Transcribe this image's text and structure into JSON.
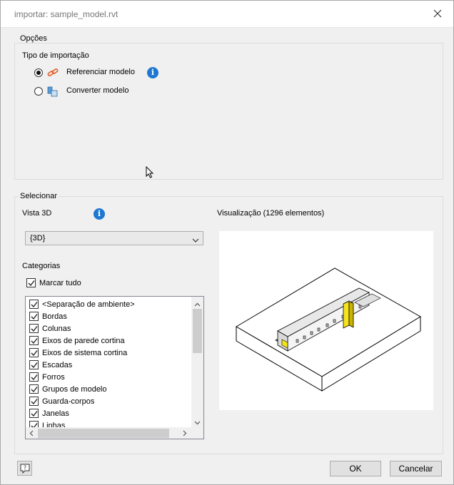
{
  "window": {
    "title": "importar: sample_model.rvt",
    "close_icon": "close-icon"
  },
  "options": {
    "group_label": "Opções",
    "import_type_label": "Tipo de importação",
    "radios": [
      {
        "label": "Referenciar modelo",
        "selected": true,
        "icon": "link-icon"
      },
      {
        "label": "Converter modelo",
        "selected": false,
        "icon": "convert-model-icon"
      }
    ],
    "info_icon": "info-icon",
    "info_glyph": "i"
  },
  "select": {
    "group_label": "Selecionar",
    "view3d_label": "Vista 3D",
    "view3d_value": "{3D}",
    "info_glyph": "i",
    "preview_label": "Visualização (1296 elementos)",
    "categories_label": "Categorias",
    "check_all_label": "Marcar tudo",
    "check_all_checked": true,
    "categories": [
      {
        "label": "<Separação de ambiente>",
        "checked": true
      },
      {
        "label": "Bordas",
        "checked": true
      },
      {
        "label": "Colunas",
        "checked": true
      },
      {
        "label": "Eixos de parede cortina",
        "checked": true
      },
      {
        "label": "Eixos de sistema cortina",
        "checked": true
      },
      {
        "label": "Escadas",
        "checked": true
      },
      {
        "label": "Forros",
        "checked": true
      },
      {
        "label": "Grupos de modelo",
        "checked": true
      },
      {
        "label": "Guarda-corpos",
        "checked": true
      },
      {
        "label": "Janelas",
        "checked": true
      },
      {
        "label": "Linhas",
        "checked": true
      }
    ]
  },
  "buttons": {
    "ok": "OK",
    "cancel": "Cancelar",
    "help_icon": "help-icon"
  },
  "colors": {
    "accent_info": "#1e78d2",
    "link_icon": "#e0602a",
    "model_highlight": "#f5e31b"
  }
}
